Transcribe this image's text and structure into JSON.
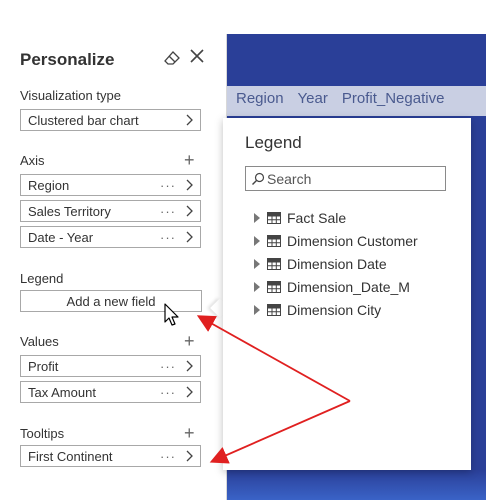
{
  "background": {
    "columns": [
      "Region",
      "Year",
      "Profit_Negative"
    ]
  },
  "panel": {
    "title": "Personalize",
    "visualization_type_label": "Visualization type",
    "visualization_type_value": "Clustered bar chart",
    "axis": {
      "label": "Axis",
      "fields": [
        "Region",
        "Sales Territory",
        "Date - Year"
      ]
    },
    "legend": {
      "label": "Legend",
      "add_field": "Add a new field"
    },
    "values": {
      "label": "Values",
      "fields": [
        "Profit",
        "Tax Amount"
      ]
    },
    "tooltips": {
      "label": "Tooltips",
      "fields": [
        "First Continent"
      ]
    },
    "more_glyph": "···"
  },
  "flyout": {
    "title": "Legend",
    "search_placeholder": "Search",
    "tables": [
      "Fact Sale",
      "Dimension Customer",
      "Dimension Date",
      "Dimension_Date_M",
      "Dimension City"
    ]
  },
  "colors": {
    "annotation_arrow": "#e02020",
    "report_background": "#1c2f8a"
  }
}
